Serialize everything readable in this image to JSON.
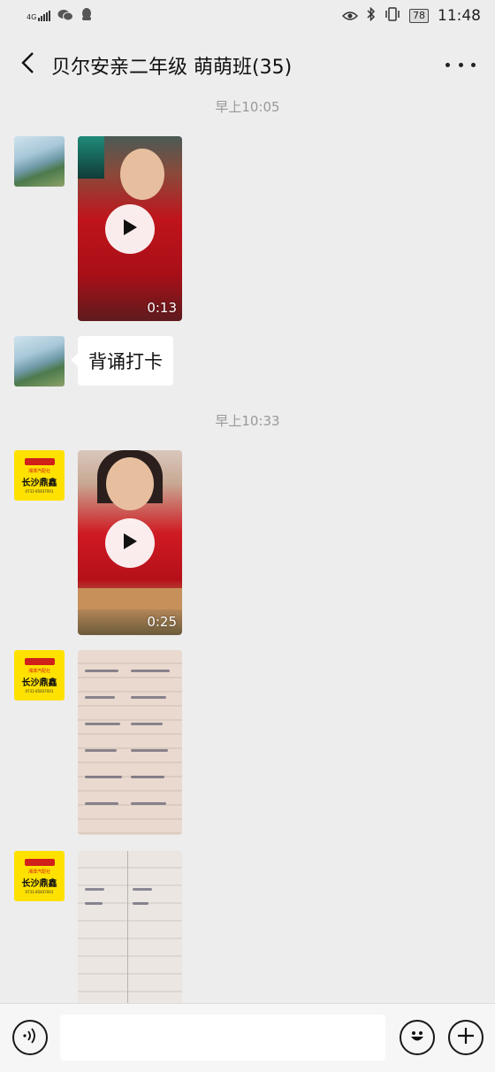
{
  "status_bar": {
    "network": "4G",
    "battery": "78",
    "time": "11:48"
  },
  "header": {
    "title": "贝尔安亲二年级 萌萌班(35)"
  },
  "messages": [
    {
      "timestamp": "早上10:05"
    },
    {
      "video_duration": "0:13"
    },
    {
      "text": "背诵打卡"
    },
    {
      "timestamp": "早上10:33"
    },
    {
      "video_duration": "0:25"
    }
  ],
  "avatar_logo": {
    "top_text": "湘潭汽配社",
    "main_text": "长沙鼎鑫",
    "bottom_text": "0731-85837001"
  },
  "input_bar": {
    "value": ""
  },
  "icons": [
    "back-arrow-icon",
    "more-icon",
    "voice-icon",
    "emoji-icon",
    "plus-icon",
    "play-icon",
    "eye-icon",
    "bluetooth-icon",
    "vibrate-icon",
    "wechat-icon",
    "qq-icon"
  ],
  "colors": {
    "background": "#ededed",
    "bubble": "#ffffff",
    "logo_yellow": "#ffe100",
    "logo_red": "#d0201a"
  }
}
